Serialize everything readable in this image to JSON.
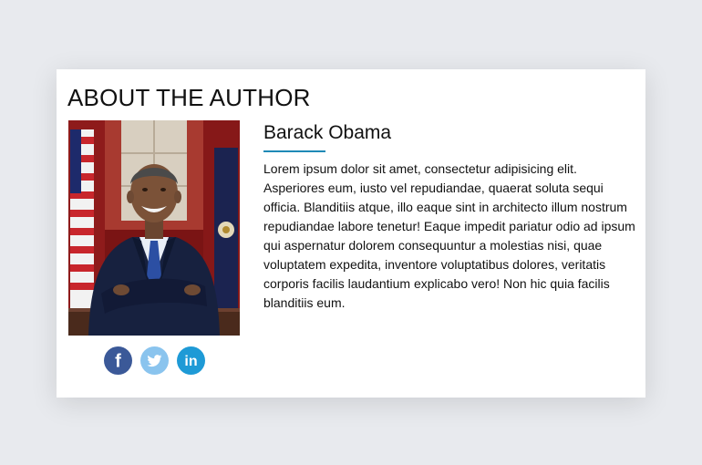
{
  "section": {
    "title": "ABOUT THE AUTHOR"
  },
  "author": {
    "name": "Barack Obama",
    "bio": "Lorem ipsum dolor sit amet, consectetur adipisicing elit. Asperiores eum, iusto vel repudiandae, quaerat soluta sequi officia. Blanditiis atque, illo eaque sint in architecto illum nostrum repudiandae labore tenetur! Eaque impedit pariatur odio ad ipsum qui aspernatur dolorem consequuntur a molestias nisi, quae voluptatem expedita, inventore voluptatibus dolores, veritatis corporis facilis laudantium explicabo vero! Non hic quia facilis blanditiis eum.",
    "accent_color": "#1f8ab6"
  },
  "social": [
    {
      "icon": "facebook-icon",
      "color": "#3b5998"
    },
    {
      "icon": "twitter-icon",
      "color": "#8ac4ee"
    },
    {
      "icon": "linkedin-icon",
      "color": "#1e9ad6"
    }
  ]
}
